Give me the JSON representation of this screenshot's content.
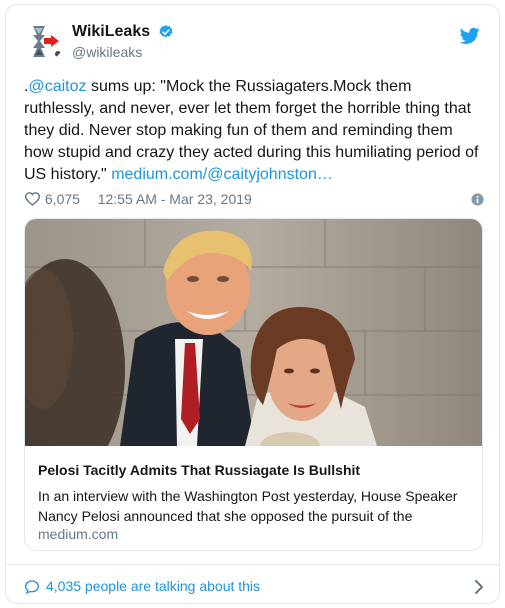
{
  "header": {
    "display_name": "WikiLeaks",
    "handle": "@wikileaks"
  },
  "tweet": {
    "prefix": ".",
    "mention": "@caitoz",
    "body": " sums up: \"Mock the Russiagaters.Mock them ruthlessly, and never, ever let them forget the horrible thing that they did. Never stop making fun of them and reminding them how stupid and crazy they acted during this humiliating period of US history.\" ",
    "link": "medium.com/@caityjohnston…"
  },
  "meta": {
    "likes": "6,075",
    "timestamp": "12:55 AM - Mar 23, 2019"
  },
  "card": {
    "title": "Pelosi Tacitly Admits That Russiagate Is Bullshit",
    "description": "In an interview with the Washington Post yesterday, House Speaker Nancy Pelosi announced that she opposed the pursuit of the",
    "domain": "medium.com"
  },
  "footer": {
    "talking": "4,035 people are talking about this"
  },
  "colors": {
    "link": "#1b95e0",
    "secondary": "#657786",
    "border": "#e1e8ed",
    "heart": "#657786"
  },
  "icons": [
    "wikileaks-hourglass-logo",
    "verified-badge-icon",
    "twitter-bird-icon",
    "heart-icon",
    "info-icon",
    "comment-bubble-icon",
    "chevron-right-icon"
  ]
}
